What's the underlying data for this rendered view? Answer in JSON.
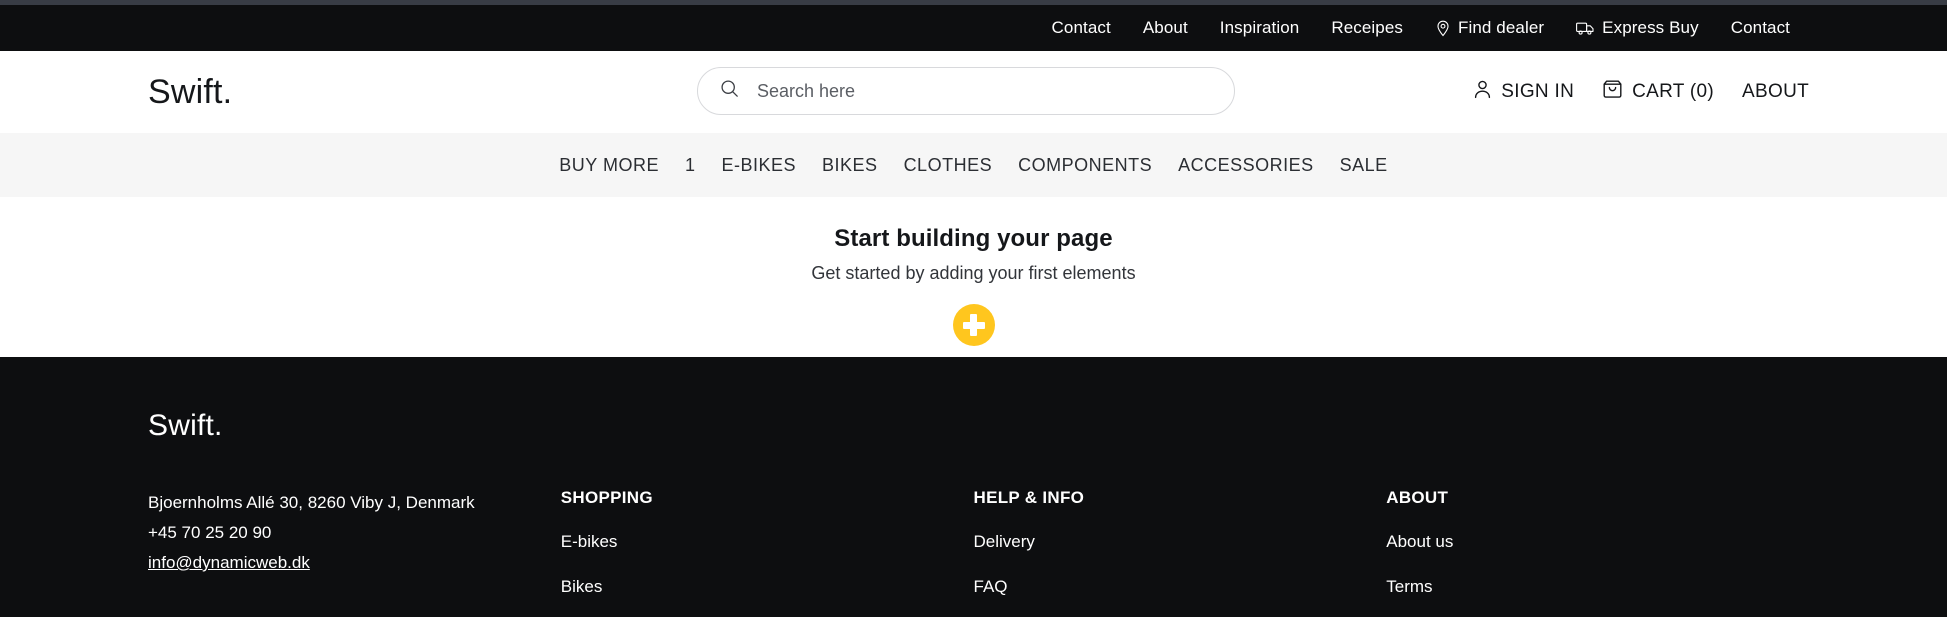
{
  "topbar": {
    "links": [
      {
        "label": "Contact",
        "icon": ""
      },
      {
        "label": "About",
        "icon": ""
      },
      {
        "label": "Inspiration",
        "icon": ""
      },
      {
        "label": "Receipes",
        "icon": ""
      },
      {
        "label": "Find dealer",
        "icon": "map-pin-icon"
      },
      {
        "label": "Express Buy",
        "icon": "truck-icon"
      },
      {
        "label": "Contact",
        "icon": ""
      }
    ]
  },
  "header": {
    "logo": "Swift.",
    "search": {
      "placeholder": "Search here",
      "value": "",
      "icon": "search-icon"
    },
    "actions": [
      {
        "label": "SIGN IN",
        "icon": "user-icon"
      },
      {
        "label": "CART (0)",
        "icon": "cart-icon"
      },
      {
        "label": "ABOUT",
        "icon": ""
      }
    ]
  },
  "catnav": {
    "items": [
      {
        "label": "BUY MORE"
      },
      {
        "label": "1"
      },
      {
        "label": "E-BIKES"
      },
      {
        "label": "BIKES"
      },
      {
        "label": "CLOTHES"
      },
      {
        "label": "COMPONENTS"
      },
      {
        "label": "ACCESSORIES"
      },
      {
        "label": "SALE"
      }
    ]
  },
  "main": {
    "title": "Start building your page",
    "subtitle": "Get started by adding your first elements",
    "add_button_icon": "plus-icon",
    "accent_color": "#ffc61e"
  },
  "footer": {
    "logo": "Swift.",
    "contact": {
      "address": "Bjoernholms Allé 30, 8260 Viby J, Denmark",
      "phone": "+45 70 25 20 90",
      "email": "info@dynamicweb.dk"
    },
    "columns": [
      {
        "heading": "SHOPPING",
        "links": [
          {
            "label": "E-bikes"
          },
          {
            "label": "Bikes"
          }
        ]
      },
      {
        "heading": "HELP & INFO",
        "links": [
          {
            "label": "Delivery"
          },
          {
            "label": "FAQ"
          }
        ]
      },
      {
        "heading": "ABOUT",
        "links": [
          {
            "label": "About us"
          },
          {
            "label": "Terms"
          }
        ]
      }
    ]
  }
}
